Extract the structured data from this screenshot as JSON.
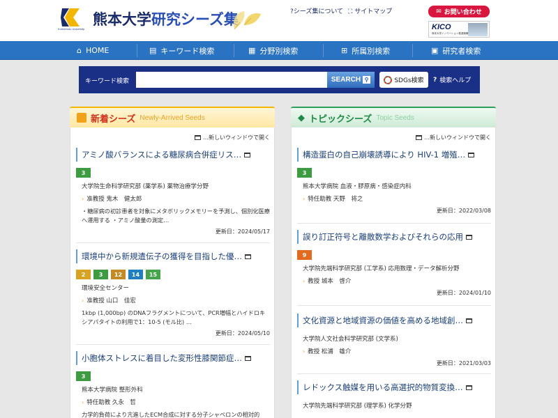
{
  "header": {
    "university_en": "Kumamoto University",
    "title_part1": "熊本大学",
    "title_part2": "研究シーズ集",
    "about_link": "シーズ集について",
    "sitemap_link": "サイトマップ",
    "contact_label": "お問い合わせ",
    "kico_label": "KICO",
    "kico_sub": "熊本大学イノベーション推進機構"
  },
  "nav": {
    "items": [
      {
        "label": "HOME",
        "icon": "home-icon"
      },
      {
        "label": "キーワード検索",
        "icon": "keyword-icon"
      },
      {
        "label": "分野別検索",
        "icon": "grid-icon"
      },
      {
        "label": "所属別検索",
        "icon": "tree-icon"
      },
      {
        "label": "研究者検索",
        "icon": "researcher-icon"
      }
    ]
  },
  "search": {
    "label": "キーワード検索",
    "placeholder": "",
    "value": "",
    "button_label": "SEARCH",
    "sdgs_label": "SDGs検索",
    "help_label": "検索ヘルプ"
  },
  "new_seeds": {
    "title": "新着シーズ",
    "subtitle": "Newly-Arrived Seeds",
    "new_window_note": "…新しいウィンドウで開く",
    "items": [
      {
        "title": "アミノ酸バランスによる糖尿病合併症リス…",
        "tags": [
          {
            "n": "3",
            "color": "#3d9c42"
          }
        ],
        "dept": "大学院生命科学研究部 (薬学系) 薬物治療学分野",
        "person": "准教授 鬼木　健太郎",
        "desc": "・糖尿病の初診患者を対象にメタボリックメモリーを予測し、個別化医療へ運用する ・アミノ酸量の測定…",
        "updated": "更新日：2024/05/17"
      },
      {
        "title": "環境中から新規遺伝子の獲得を目指した優…",
        "tags": [
          {
            "n": "2",
            "color": "#d9a222"
          },
          {
            "n": "3",
            "color": "#3d9c42"
          },
          {
            "n": "12",
            "color": "#c58a25"
          },
          {
            "n": "14",
            "color": "#1f7fc3"
          },
          {
            "n": "15",
            "color": "#46a44a"
          }
        ],
        "dept": "環境安全センター",
        "person": "准教授 山口　佳宏",
        "desc": "1kbp (1,000bp) のDNAフラグメントについて、PCR増幅とハイドロキシアパタイトの利用で1：10-5 (モル比) …",
        "updated": "更新日：2024/05/10"
      },
      {
        "title": "小胞体ストレスに着目した変形性膝関節症…",
        "tags": [
          {
            "n": "3",
            "color": "#3d9c42"
          }
        ],
        "dept": "熊本大学病院 整形外科",
        "person": "特任助教 久永　哲",
        "desc": "力学的負荷により亢進したECM合成に対する分子シャペロンの相対的",
        "updated": ""
      }
    ]
  },
  "topic_seeds": {
    "title": "トピックシーズ",
    "subtitle": "Topic Seeds",
    "new_window_note": "…新しいウィンドウで開く",
    "items": [
      {
        "title": "構造蛋白の自己崩壊誘導により HIV-1 増殖…",
        "tags": [
          {
            "n": "3",
            "color": "#3d9c42"
          }
        ],
        "dept": "熊本大学病院 血液・膠原病・感染症内科",
        "person": "特任助教 天野　将之",
        "updated": "更新日：2022/03/08"
      },
      {
        "title": "誤り訂正符号と離散数学およびそれらの応用",
        "tags": [
          {
            "n": "9",
            "color": "#e36a1f"
          }
        ],
        "dept": "大学院先端科学研究部 (工学系) 応用数理・データ解析分野",
        "person": "教授 城本　啓介",
        "updated": "更新日：2024/01/10"
      },
      {
        "title": "文化資源と地域資源の価値を高める地域創…",
        "tags": [],
        "dept": "大学院人文社会科学研究部 (文学系)",
        "person": "教授 松浦　雄介",
        "updated": "更新日：2021/03/03"
      },
      {
        "title": "レドックス触媒を用いる高選択的物質変換…",
        "tags": [],
        "dept": "大学院先端科学研究部 (理学系) 化学分野",
        "person": "",
        "updated": ""
      }
    ]
  }
}
